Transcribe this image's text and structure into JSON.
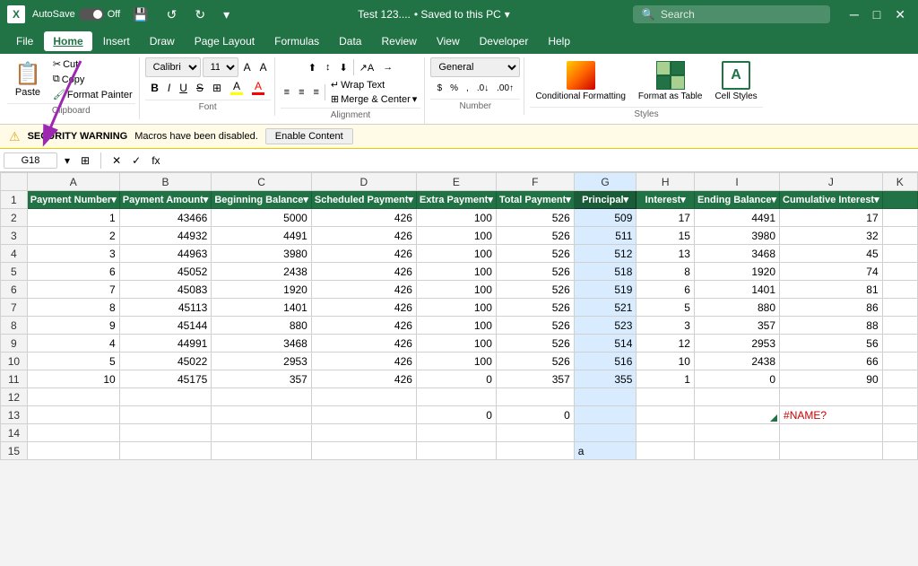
{
  "titlebar": {
    "logo": "X",
    "autosave_label": "AutoSave",
    "toggle_state": "Off",
    "title": "Test 123....",
    "saved_label": "• Saved to this PC",
    "saved_arrow": "▾",
    "search_placeholder": "Search",
    "undo_label": "↺",
    "redo_label": "↻"
  },
  "menubar": {
    "items": [
      "File",
      "Home",
      "Insert",
      "Draw",
      "Page Layout",
      "Formulas",
      "Data",
      "Review",
      "View",
      "Developer",
      "Help"
    ]
  },
  "ribbon": {
    "clipboard": {
      "paste_label": "Paste",
      "cut_label": "Cut",
      "copy_label": "Copy",
      "format_painter_label": "Format Painter",
      "group_label": "Clipboard"
    },
    "font": {
      "font_name": "Calibri",
      "font_size": "11",
      "grow_label": "A",
      "shrink_label": "A",
      "bold_label": "B",
      "italic_label": "I",
      "underline_label": "U",
      "strikethrough_label": "S",
      "border_label": "⊞",
      "fill_color_label": "A",
      "font_color_label": "A",
      "fill_color": "#FFFF00",
      "font_color": "#FF0000",
      "group_label": "Font"
    },
    "alignment": {
      "top_align": "⊤",
      "mid_align": "≡",
      "bot_align": "⊥",
      "left_align": "≡",
      "center_align": "≡",
      "right_align": "≡",
      "decrease_indent": "←",
      "increase_indent": "→",
      "wrap_text_label": "Wrap Text",
      "merge_center_label": "Merge & Center",
      "group_label": "Alignment"
    },
    "number": {
      "format_label": "General",
      "currency_label": "$",
      "percent_label": "%",
      "comma_label": ",",
      "decrease_decimal": ".0",
      "increase_decimal": ".00",
      "group_label": "Number"
    },
    "styles": {
      "conditional_label": "Conditional Formatting",
      "format_table_label": "Format as Table",
      "cell_styles_label": "Cell Styles",
      "group_label": "Styles"
    }
  },
  "formula_bar": {
    "cell_ref": "G18",
    "cancel_btn": "✕",
    "confirm_btn": "✓",
    "function_btn": "fx",
    "formula": ""
  },
  "security_warning": {
    "icon": "⚠",
    "bold_text": "SECURITY WARNING",
    "message": "Macros have been disabled.",
    "enable_btn_label": "Enable Content"
  },
  "spreadsheet": {
    "col_headers": [
      "",
      "A",
      "B",
      "C",
      "D",
      "E",
      "F",
      "G",
      "H",
      "I",
      "J",
      "K"
    ],
    "rows": [
      {
        "row_num": "1",
        "cells": [
          "Payment Number▾",
          "Payment Amount▾",
          "Beginning Balance▾",
          "Scheduled Payment▾",
          "Extra Payment▾",
          "Total Payment▾",
          "Principal▾",
          "Interest▾",
          "Ending Balance▾",
          "Cumulative Interest▾",
          ""
        ]
      },
      {
        "row_num": "2",
        "cells": [
          "1",
          "43466",
          "5000",
          "426",
          "100",
          "526",
          "509",
          "17",
          "4491",
          "17",
          ""
        ]
      },
      {
        "row_num": "3",
        "cells": [
          "2",
          "44932",
          "4491",
          "426",
          "100",
          "526",
          "511",
          "15",
          "3980",
          "32",
          ""
        ]
      },
      {
        "row_num": "4",
        "cells": [
          "3",
          "44963",
          "3980",
          "426",
          "100",
          "526",
          "512",
          "13",
          "3468",
          "45",
          ""
        ]
      },
      {
        "row_num": "5",
        "cells": [
          "6",
          "45052",
          "2438",
          "426",
          "100",
          "526",
          "518",
          "8",
          "1920",
          "74",
          ""
        ]
      },
      {
        "row_num": "6",
        "cells": [
          "7",
          "45083",
          "1920",
          "426",
          "100",
          "526",
          "519",
          "6",
          "1401",
          "81",
          ""
        ]
      },
      {
        "row_num": "7",
        "cells": [
          "8",
          "45113",
          "1401",
          "426",
          "100",
          "526",
          "521",
          "5",
          "880",
          "86",
          ""
        ]
      },
      {
        "row_num": "8",
        "cells": [
          "9",
          "45144",
          "880",
          "426",
          "100",
          "526",
          "523",
          "3",
          "357",
          "88",
          ""
        ]
      },
      {
        "row_num": "9",
        "cells": [
          "4",
          "44991",
          "3468",
          "426",
          "100",
          "526",
          "514",
          "12",
          "2953",
          "56",
          ""
        ]
      },
      {
        "row_num": "10",
        "cells": [
          "5",
          "45022",
          "2953",
          "426",
          "100",
          "526",
          "516",
          "10",
          "2438",
          "66",
          ""
        ]
      },
      {
        "row_num": "11",
        "cells": [
          "10",
          "45175",
          "357",
          "426",
          "0",
          "357",
          "355",
          "1",
          "0",
          "90",
          ""
        ]
      },
      {
        "row_num": "12",
        "cells": [
          "",
          "",
          "",
          "",
          "",
          "",
          "",
          "",
          "",
          "",
          ""
        ]
      },
      {
        "row_num": "13",
        "cells": [
          "",
          "",
          "",
          "",
          "0",
          "0",
          "",
          "",
          "",
          "#NAME?",
          ""
        ]
      },
      {
        "row_num": "14",
        "cells": [
          "",
          "",
          "",
          "",
          "",
          "",
          "",
          "",
          "",
          "",
          ""
        ]
      },
      {
        "row_num": "15",
        "cells": [
          "",
          "",
          "",
          "",
          "",
          "",
          "a",
          "",
          "",
          "",
          ""
        ]
      }
    ]
  }
}
